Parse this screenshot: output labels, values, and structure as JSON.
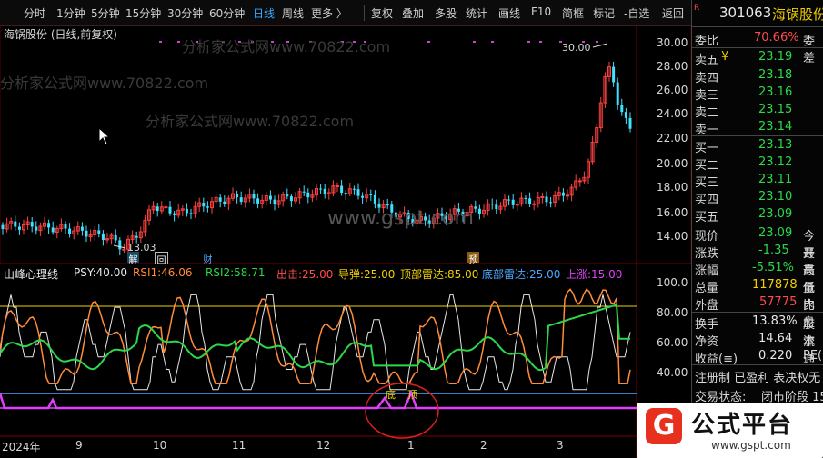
{
  "toolbar": {
    "items": [
      "分时",
      "1分钟",
      "5分钟",
      "15分钟",
      "30分钟",
      "60分钟",
      "日线",
      "周线",
      "更多 〉"
    ],
    "actions": [
      "复权",
      "叠加",
      "多股",
      "统计",
      "画线",
      "F10",
      "简框",
      "标记",
      "-自选",
      "返回"
    ]
  },
  "chart": {
    "title": "海锅股份 (日线,前复权)",
    "watermarks": [
      "分析家公式网www.70822.com",
      "www.gspt.com"
    ],
    "price_axis": [
      "30.00",
      "28.00",
      "26.00",
      "24.00",
      "22.00",
      "20.00",
      "18.00",
      "16.00",
      "14.00"
    ],
    "high_label": "30.00",
    "low_label": "13.03",
    "event_markers": [
      "解",
      "回",
      "财",
      "预"
    ]
  },
  "indicator": {
    "name": "山峰心理线",
    "legend": [
      {
        "label": "PSY:",
        "value": "40.00",
        "color": "#e8e8e8"
      },
      {
        "label": "RSI1:",
        "value": "46.06",
        "color": "#ff8c3a"
      },
      {
        "label": "RSI2:",
        "value": "58.71",
        "color": "#2cd84a"
      },
      {
        "label": "出击:",
        "value": "25.00",
        "color": "#ff4b4b"
      },
      {
        "label": "导弹:",
        "value": "25.00",
        "color": "#f0d000"
      },
      {
        "label": "顶部雷达:",
        "value": "85.00",
        "color": "#f0d000"
      },
      {
        "label": "底部雷达:",
        "value": "25.00",
        "color": "#4aa8ff"
      },
      {
        "label": "上涨:",
        "value": "15.00",
        "color": "#e040fb"
      }
    ],
    "axis": [
      "100.0",
      "80.00",
      "60.00",
      "40.00"
    ],
    "markers": [
      "底",
      "顶"
    ]
  },
  "x_axis": [
    "2024年",
    "9",
    "10",
    "11",
    "12",
    "1",
    "2",
    "3"
  ],
  "quote": {
    "code": "301063",
    "name": "海锅股份",
    "webi_label": "委比",
    "webi_value": "70.66%",
    "weicha_label": "委差",
    "asks": [
      {
        "label": "卖五",
        "extra": "¥",
        "price": "23.19"
      },
      {
        "label": "卖四",
        "extra": "",
        "price": "23.18"
      },
      {
        "label": "卖三",
        "extra": "",
        "price": "23.16"
      },
      {
        "label": "卖二",
        "extra": "",
        "price": "23.15"
      },
      {
        "label": "卖一",
        "extra": "",
        "price": "23.14"
      }
    ],
    "bids": [
      {
        "label": "买一",
        "price": "23.13"
      },
      {
        "label": "买二",
        "price": "23.12"
      },
      {
        "label": "买三",
        "price": "23.11"
      },
      {
        "label": "买四",
        "price": "23.10"
      },
      {
        "label": "买五",
        "price": "23.09"
      }
    ],
    "stats": [
      {
        "label": "现价",
        "value": "23.09",
        "extra": "今开",
        "color": "#2cd84a"
      },
      {
        "label": "涨跌",
        "value": "-1.35",
        "extra": "最高",
        "color": "#2cd84a"
      },
      {
        "label": "涨幅",
        "value": "-5.51%",
        "extra": "最低",
        "color": "#2cd84a"
      },
      {
        "label": "总量",
        "value": "117878",
        "extra": "量比",
        "color": "#f0d000"
      },
      {
        "label": "外盘",
        "value": "57775",
        "extra": "内盘",
        "color": "#ff4b4b"
      },
      {
        "label": "换手",
        "value": "13.83%",
        "extra": "股本",
        "color": "#e8e8e8"
      },
      {
        "label": "净资",
        "value": "14.64",
        "extra": "流通",
        "color": "#e8e8e8"
      },
      {
        "label": "收益(≡)",
        "value": "0.220",
        "extra": "PE(",
        "color": "#e8e8e8"
      }
    ],
    "tags": "注册制 已盈利 表决权无",
    "status_label": "交易状态:",
    "status_value": "闭市阶段 15"
  },
  "logo": {
    "text": "公式平台",
    "url": "www.gspt.com"
  }
}
